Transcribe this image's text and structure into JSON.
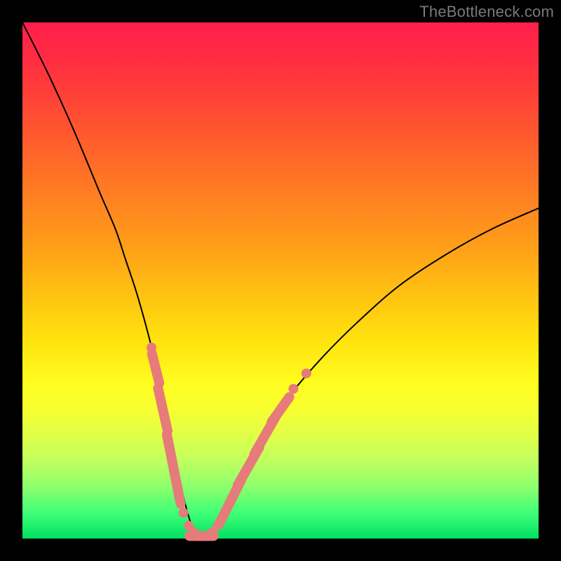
{
  "watermark": "TheBottleneck.com",
  "colors": {
    "frame": "#000000",
    "curve": "#000000",
    "markers": "#e77a7a",
    "gradient_top": "#ff1f4a",
    "gradient_bottom": "#00e060"
  },
  "chart_data": {
    "type": "line",
    "title": "",
    "xlabel": "",
    "ylabel": "",
    "xlim": [
      0,
      100
    ],
    "ylim": [
      0,
      100
    ],
    "grid": false,
    "legend": false,
    "annotations": [
      "TheBottleneck.com"
    ],
    "series": [
      {
        "name": "bottleneck-curve",
        "x": [
          0,
          5,
          10,
          15,
          18,
          20,
          22,
          24,
          26,
          28,
          30,
          31,
          32,
          33,
          34,
          35,
          36,
          37,
          38,
          40,
          43,
          47,
          52,
          58,
          65,
          73,
          82,
          91,
          100
        ],
        "y": [
          100,
          90,
          79,
          67,
          60,
          54,
          48,
          41,
          33,
          24,
          14,
          9,
          5,
          2,
          0.8,
          0.3,
          0.8,
          2,
          4,
          8,
          14,
          21,
          28,
          35,
          42,
          49,
          55,
          60,
          64
        ]
      }
    ],
    "markers": [
      {
        "x": 25.0,
        "y": 37,
        "kind": "dot"
      },
      {
        "x": 25.8,
        "y": 33,
        "kind": "capsule",
        "len": 6
      },
      {
        "x": 27.2,
        "y": 25,
        "kind": "capsule",
        "len": 8
      },
      {
        "x": 28.8,
        "y": 16,
        "kind": "capsule",
        "len": 8
      },
      {
        "x": 30.2,
        "y": 9,
        "kind": "capsule",
        "len": 5
      },
      {
        "x": 31.2,
        "y": 5,
        "kind": "dot"
      },
      {
        "x": 32.2,
        "y": 2.5,
        "kind": "dot"
      },
      {
        "x": 33.2,
        "y": 1.2,
        "kind": "dot"
      },
      {
        "x": 34.0,
        "y": 0.5,
        "kind": "capsule",
        "len": 4,
        "horiz": true
      },
      {
        "x": 35.4,
        "y": 0.5,
        "kind": "capsule",
        "len": 4,
        "horiz": true
      },
      {
        "x": 36.8,
        "y": 1.2,
        "kind": "dot"
      },
      {
        "x": 37.8,
        "y": 2.5,
        "kind": "dot"
      },
      {
        "x": 39.2,
        "y": 5,
        "kind": "capsule",
        "len": 5
      },
      {
        "x": 41.2,
        "y": 9,
        "kind": "capsule",
        "len": 6
      },
      {
        "x": 43.8,
        "y": 14,
        "kind": "capsule",
        "len": 8
      },
      {
        "x": 47.0,
        "y": 20,
        "kind": "capsule",
        "len": 8
      },
      {
        "x": 50.0,
        "y": 25,
        "kind": "capsule",
        "len": 6
      },
      {
        "x": 52.5,
        "y": 29,
        "kind": "dot"
      },
      {
        "x": 55.0,
        "y": 32,
        "kind": "dot"
      }
    ]
  }
}
